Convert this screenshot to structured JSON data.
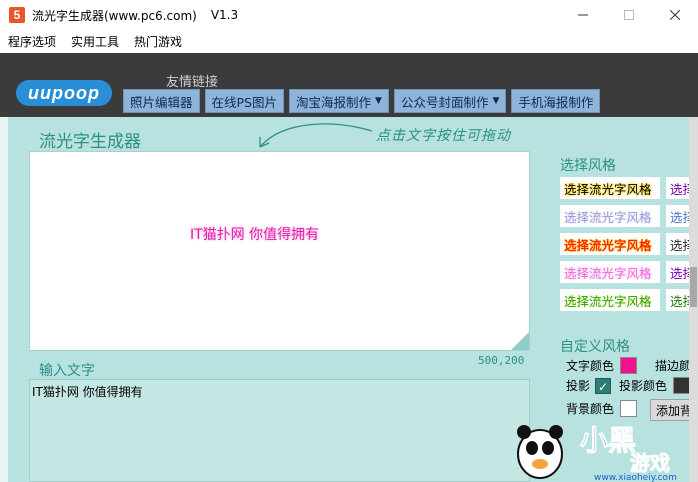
{
  "window": {
    "title": "流光字生成器(www.pc6.com)",
    "version": "V1.3",
    "icon_letter": "5",
    "controls": [
      "minimize-icon",
      "maximize-icon",
      "close-icon"
    ]
  },
  "menu": {
    "items": [
      "程序选项",
      "实用工具",
      "热门游戏"
    ]
  },
  "header": {
    "logo_text": "uupoop",
    "friend_link": "友情链接",
    "nav": [
      {
        "label": "照片编辑器",
        "dropdown": false
      },
      {
        "label": "在线PS图片",
        "dropdown": false
      },
      {
        "label": "淘宝海报制作",
        "dropdown": true
      },
      {
        "label": "公众号封面制作",
        "dropdown": true
      },
      {
        "label": "手机海报制作",
        "dropdown": false
      }
    ]
  },
  "editor": {
    "title": "流光字生成器",
    "hint": "点击文字按住可拖动",
    "canvas_text": "IT猫扑网 你值得拥有",
    "canvas_size": "500,200",
    "input_label": "输入文字",
    "input_value": "IT猫扑网 你值得拥有"
  },
  "styles": {
    "title": "选择风格",
    "rows": [
      {
        "label": "选择流光字风格",
        "partial": "选择"
      },
      {
        "label": "选择流光字风格",
        "partial": "选择"
      },
      {
        "label": "选择流光字风格",
        "partial": "选择"
      },
      {
        "label": "选择流光字风格",
        "partial": "选择"
      },
      {
        "label": "选择流光字风格",
        "partial": "选择"
      }
    ]
  },
  "custom": {
    "title": "自定义风格",
    "text_color_label": "文字颜色",
    "text_color": "#f0118c",
    "stroke_label": "描边颜",
    "shadow_label": "投影",
    "shadow_checked": true,
    "shadow_color_label": "投影颜色",
    "shadow_color": "#333333",
    "bg_color_label": "背景颜色",
    "bg_color": "#ffffff",
    "add_button": "添加背"
  },
  "colors": {
    "accent": "#2d8f87",
    "panel_bg": "#b8e2df",
    "header_bg": "#3b3b3b",
    "nav_btn": "#8fb3d9"
  }
}
